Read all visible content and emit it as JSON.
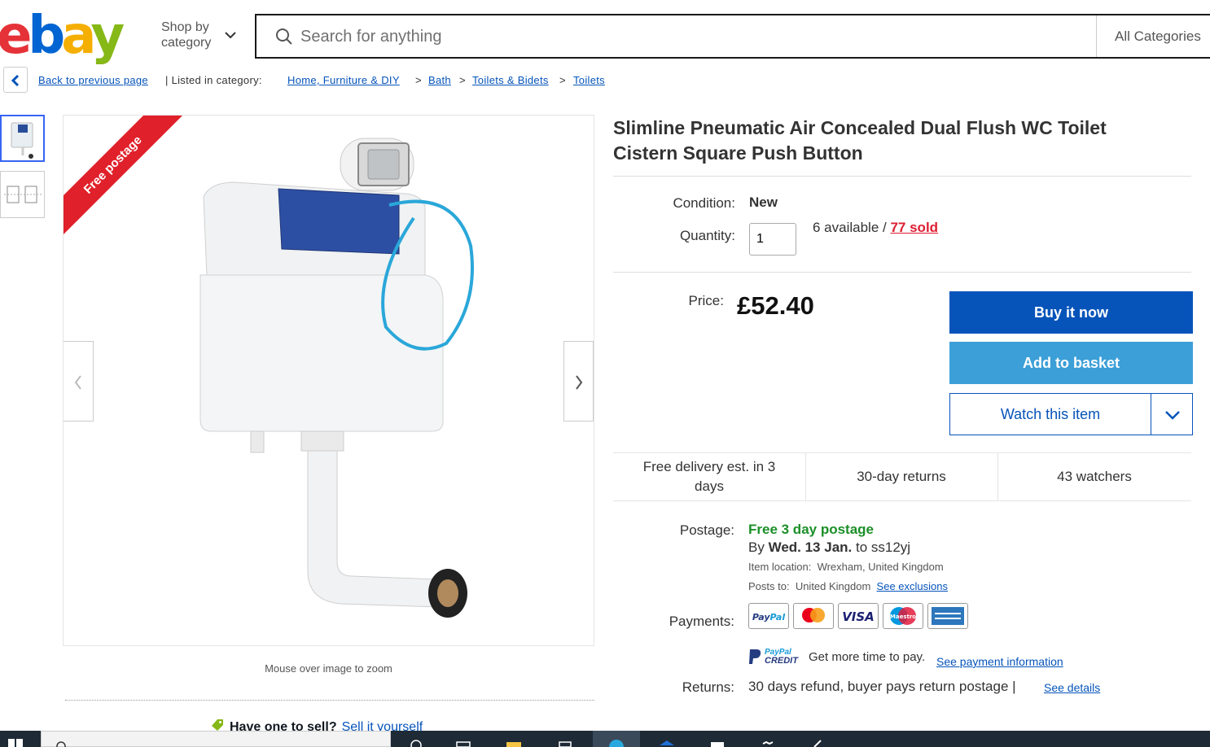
{
  "header": {
    "logo_letters": [
      "e",
      "b",
      "a",
      "y"
    ],
    "shop_by_line1": "Shop by",
    "shop_by_line2": "category",
    "search_placeholder": "Search for anything",
    "category_select": "All Categories"
  },
  "breadcrumb": {
    "back_label": "Back to previous page",
    "listed_in": "| Listed in category:",
    "items": [
      "Home, Furniture & DIY",
      "Bath",
      "Toilets & Bidets",
      "Toilets"
    ],
    "separator": ">"
  },
  "gallery": {
    "ribbon": "Free postage",
    "zoom_hint": "Mouse over image to zoom",
    "sell_question": "Have one to sell?",
    "sell_link": "Sell it yourself"
  },
  "item": {
    "title_line1": "Slimline Pneumatic Air Concealed Dual Flush WC Toilet",
    "title_line2": "Cistern Square Push Button",
    "condition_label": "Condition:",
    "condition_value": "New",
    "quantity_label": "Quantity:",
    "quantity_value": "1",
    "available_text": "6 available /",
    "sold_text": "77 sold",
    "price_label": "Price:",
    "price_value": "£52.40"
  },
  "actions": {
    "buy_now": "Buy it now",
    "add_to_basket": "Add to basket",
    "watch": "Watch this item"
  },
  "features": {
    "delivery": "Free delivery est. in 3 days",
    "returns": "30-day returns",
    "watchers": "43 watchers"
  },
  "postage": {
    "label": "Postage:",
    "free_text": "Free 3 day postage",
    "by_prefix": "By",
    "by_date": "Wed. 13 Jan.",
    "by_suffix": "to ss12yj",
    "location_label": "Item location:",
    "location_value": "Wrexham, United Kingdom",
    "posts_to_label": "Posts to:",
    "posts_to_value": "United Kingdom",
    "exclusions_link": "See exclusions"
  },
  "payments": {
    "label": "Payments:",
    "methods": [
      "PayPal",
      "Mastercard",
      "VISA",
      "Maestro",
      "American Express"
    ],
    "paypal_credit_top": "PayPal",
    "paypal_credit_bottom": "CREDIT",
    "credit_text": "Get more time to pay.",
    "info_link": "See payment information"
  },
  "returns": {
    "label": "Returns:",
    "text": "30 days refund, buyer pays return postage |",
    "link": "See details"
  },
  "colors": {
    "ebay_red": "#e53238",
    "ebay_blue": "#0064d2",
    "ebay_yellow": "#f5af02",
    "ebay_green": "#86b817",
    "buy_button": "#0654ba",
    "basket_button": "#3c9fd8",
    "link": "#0654ba",
    "sold_red": "#dd1e31",
    "free_green": "#1c8f28"
  }
}
